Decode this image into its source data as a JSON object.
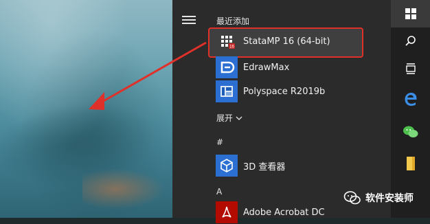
{
  "recent": {
    "header": "最近添加",
    "items": [
      {
        "label": "StataMP 16 (64-bit)",
        "icon": "stata-icon"
      },
      {
        "label": "EdrawMax",
        "icon": "edrawmax-icon"
      },
      {
        "label": "Polyspace R2019b",
        "icon": "polyspace-icon"
      }
    ]
  },
  "expand_label": "展开",
  "groups": [
    {
      "header": "#",
      "items": [
        {
          "label": "3D 查看器",
          "icon": "3d-viewer-icon"
        }
      ]
    },
    {
      "header": "A",
      "items": [
        {
          "label": "Adobe Acrobat DC",
          "icon": "acrobat-icon"
        }
      ]
    }
  ],
  "sidebar_icons": [
    "windows-logo-icon",
    "search-icon",
    "task-view-icon",
    "edge-icon",
    "wechat-icon",
    "folder-icon"
  ],
  "watermark": {
    "text": "软件安装师"
  },
  "colors": {
    "highlight": "#e0302a",
    "arrow": "#e0302a",
    "panel": "#2b2b2b",
    "tile_blue": "#2b6fd3"
  }
}
